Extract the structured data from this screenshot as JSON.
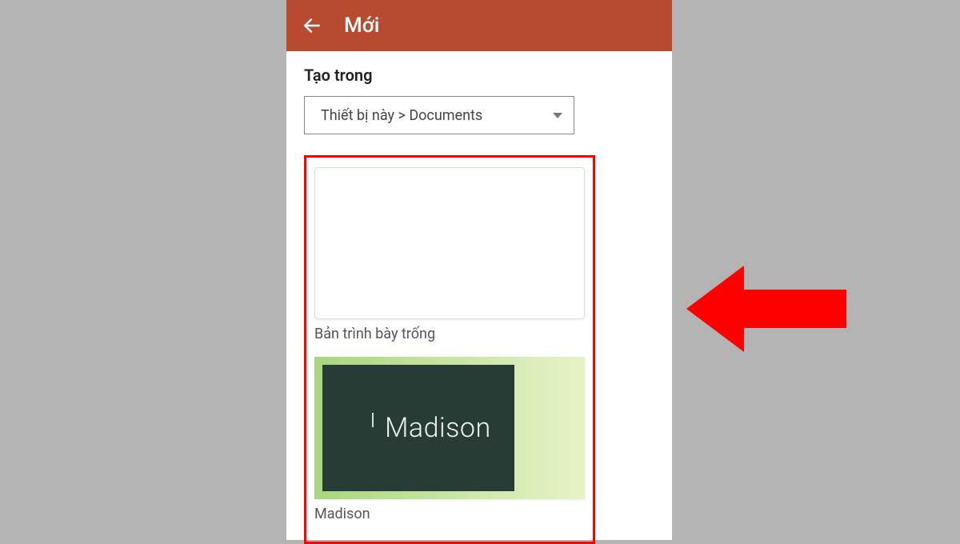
{
  "appbar": {
    "title": "Mới"
  },
  "create_in": {
    "label": "Tạo trong",
    "selected": "Thiết bị này > Documents"
  },
  "templates": {
    "blank_label": "Bản trình bày trống",
    "madison_thumb_text": "Madison",
    "madison_label": "Madison"
  }
}
